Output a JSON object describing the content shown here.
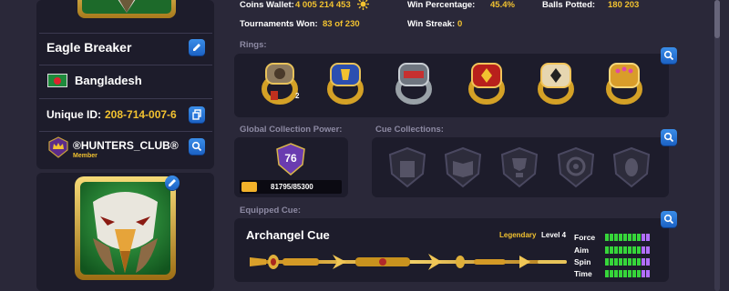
{
  "sidebar": {
    "player_name": "Eagle Breaker",
    "country": "Bangladesh",
    "unique_id_label": "Unique ID:",
    "unique_id_value": "208-714-007-6",
    "club_name": "®HUNTERS_CLUB®",
    "club_role": "Member"
  },
  "stats": {
    "coins_wallet_label": "Coins Wallet:",
    "coins_wallet_value": "4 005 214 453",
    "win_percentage_label": "Win Percentage:",
    "win_percentage_value": "45.4%",
    "balls_potted_label": "Balls Potted:",
    "balls_potted_value": "180 203",
    "tournaments_won_label": "Tournaments Won:",
    "tournaments_won_value": "83 of 230",
    "win_streak_label": "Win Streak:",
    "win_streak_value": "0"
  },
  "rings": {
    "label": "Rings:",
    "first_ring_count": "2"
  },
  "collection_power": {
    "label": "Global Collection Power:",
    "level": "76",
    "progress_text": "81795/85300",
    "progress_fraction": 0.959
  },
  "cue_collections": {
    "label": "Cue Collections:"
  },
  "equipped_cue": {
    "label": "Equipped Cue:",
    "name": "Archangel Cue",
    "rarity": "Legendary",
    "level": "Level 4",
    "stats": [
      {
        "name": "Force",
        "value": 8,
        "max": 10
      },
      {
        "name": "Aim",
        "value": 8,
        "max": 10
      },
      {
        "name": "Spin",
        "value": 8,
        "max": 10
      },
      {
        "name": "Time",
        "value": 8,
        "max": 10
      }
    ]
  },
  "colors": {
    "background": "#2a2839",
    "panel": "#1d1c2b",
    "accent_gold": "#f2c230",
    "button_blue": "#2a78dd",
    "bar_green": "#36d63a",
    "bar_purple": "#b16fff"
  },
  "icons": [
    "edit-icon",
    "copy-icon",
    "search-icon",
    "coins-sun-icon",
    "bangladesh-flag-icon",
    "club-crown-icon",
    "eagle-avatar-icon"
  ]
}
